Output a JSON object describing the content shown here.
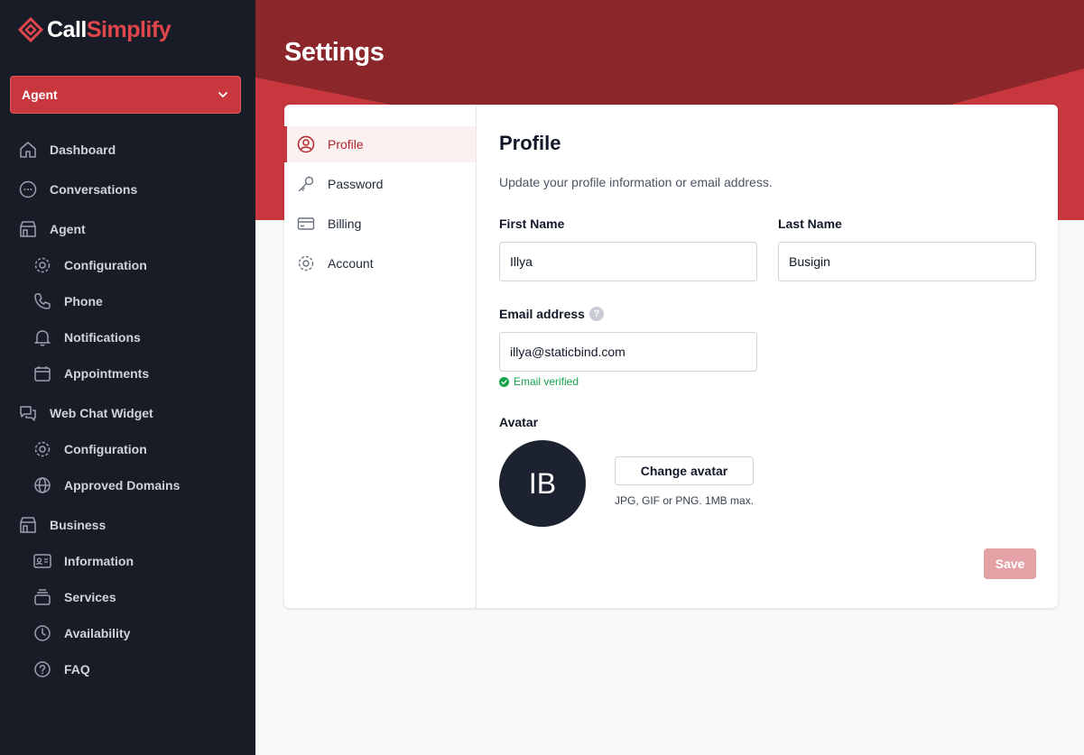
{
  "brand": {
    "name_part1": "Call",
    "name_part2": "Simplify"
  },
  "agent_select": {
    "value": "Agent"
  },
  "sidebar": {
    "items": [
      {
        "label": "Dashboard",
        "icon": "home-icon"
      },
      {
        "label": "Conversations",
        "icon": "chat-bubble-icon"
      },
      {
        "label": "Agent",
        "icon": "storefront-icon"
      },
      {
        "label": "Configuration",
        "icon": "gear-icon"
      },
      {
        "label": "Phone",
        "icon": "phone-icon"
      },
      {
        "label": "Notifications",
        "icon": "bell-icon"
      },
      {
        "label": "Appointments",
        "icon": "calendar-icon"
      },
      {
        "label": "Web Chat Widget",
        "icon": "chat-bubbles-icon"
      },
      {
        "label": "Configuration",
        "icon": "gear-icon"
      },
      {
        "label": "Approved Domains",
        "icon": "globe-icon"
      },
      {
        "label": "Business",
        "icon": "storefront-icon"
      },
      {
        "label": "Information",
        "icon": "id-card-icon"
      },
      {
        "label": "Services",
        "icon": "stack-icon"
      },
      {
        "label": "Availability",
        "icon": "clock-icon"
      },
      {
        "label": "FAQ",
        "icon": "question-circle-icon"
      }
    ]
  },
  "page": {
    "title": "Settings"
  },
  "settings_nav": {
    "items": [
      {
        "label": "Profile",
        "icon": "user-circle-icon",
        "active": true
      },
      {
        "label": "Password",
        "icon": "key-icon",
        "active": false
      },
      {
        "label": "Billing",
        "icon": "credit-card-icon",
        "active": false
      },
      {
        "label": "Account",
        "icon": "cog-icon",
        "active": false
      }
    ]
  },
  "profile": {
    "heading": "Profile",
    "description": "Update your profile information or email address.",
    "first_name": {
      "label": "First Name",
      "value": "Illya"
    },
    "last_name": {
      "label": "Last Name",
      "value": "Busigin"
    },
    "email": {
      "label": "Email address",
      "value": "illya@staticbind.com",
      "help": "?",
      "status": "Email verified"
    },
    "avatar": {
      "label": "Avatar",
      "initials": "IB",
      "button": "Change avatar",
      "hint": "JPG, GIF or PNG. 1MB max."
    },
    "save_label": "Save"
  },
  "colors": {
    "brand_red": "#c7373d",
    "sidebar_bg": "#181c27",
    "header_dark": "#8b262b",
    "success": "#16a34a"
  }
}
